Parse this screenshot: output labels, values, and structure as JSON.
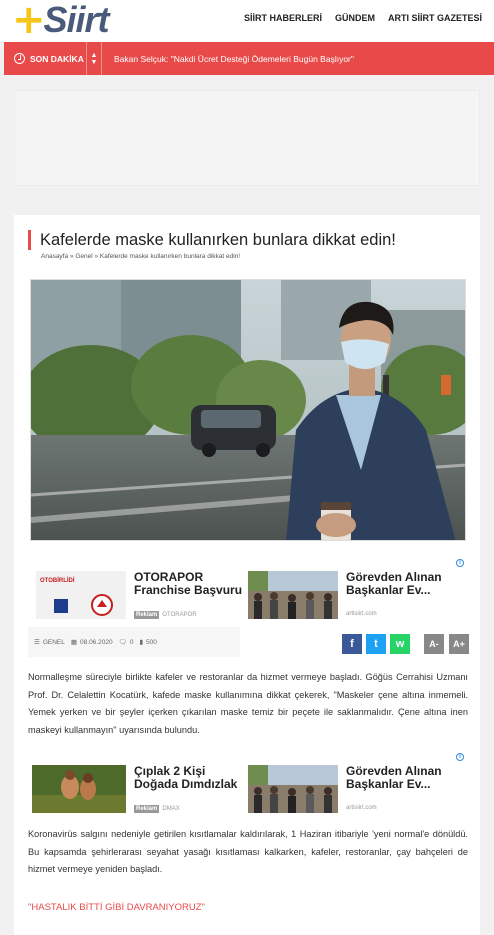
{
  "header": {
    "logo_plus": "+",
    "logo_text": "Siirt",
    "nav": [
      "SİİRT HABERLERİ",
      "GÜNDEM",
      "ARTI SİİRT GAZETESİ"
    ]
  },
  "breaking": {
    "label": "SON DAKİKA",
    "headline": "Bakan Selçuk: \"Nakdi Ücret Desteği Ödemeleri Bugün Başlıyor\""
  },
  "article": {
    "title": "Kafelerde maske kullanırken bunlara dikkat edin!",
    "breadcrumb": "Anasayfa » Genel » Kafelerde maske kullanırken bunlara dikkat edin!",
    "meta": {
      "category": "GENEL",
      "date": "08.06.2020",
      "comments": "0",
      "views": "500"
    },
    "paragraph1": "Normalleşme süreciyle birlikte kafeler ve restoranlar da hizmet vermeye başladı. Göğüs Cerrahisi Uzmanı Prof. Dr. Celalettin Kocatürk, kafede maske kullanımına dikkat çekerek, \"Maskeler çene altına inmemeli. Yemek yerken ve bir şeyler içerken çıkarılan maske temiz bir peçete ile saklanmalıdır. Çene altına inen maskeyi kullanmayın\" uyarısında bulundu.",
    "paragraph2": "Koronavirüs salgını nedeniyle getirilen kısıtlamalar kaldırılarak, 1 Haziran itibariyle 'yeni normal'e dönüldü. Bu kapsamda şehirlerarası seyahat yasağı kısıtlaması kalkarken, kafeler, restoranlar, çay bahçeleri de hizmet vermeye yeniden başladı.",
    "subheading": "\"HASTALIK BİTTİ GİBİ DAVRANIYORUZ\""
  },
  "ads1": [
    {
      "title": "OTORAPOR Franchise Başvuru",
      "tag": "Reklam",
      "source": "OTORAPOR",
      "thumb_text": "OTOBİRLİDİ"
    },
    {
      "title": "Görevden Alınan Başkanlar Ev...",
      "tag": "",
      "source": "artisiirt.com"
    }
  ],
  "ads2": [
    {
      "title": "Çıplak 2 Kişi Doğada Dımdızlak",
      "tag": "Reklam",
      "source": "DMAX"
    },
    {
      "title": "Görevden Alınan Başkanlar Ev...",
      "tag": "",
      "source": "artisiirt.com"
    }
  ],
  "ad_info": "i",
  "share": {
    "facebook": "f",
    "twitter": "t",
    "whatsapp": "w"
  },
  "font_buttons": {
    "decrease": "A-",
    "increase": "A+"
  },
  "colors": {
    "accent": "#e84a4a",
    "facebook": "#3b5998",
    "twitter": "#1da1f2",
    "whatsapp": "#25d366"
  }
}
